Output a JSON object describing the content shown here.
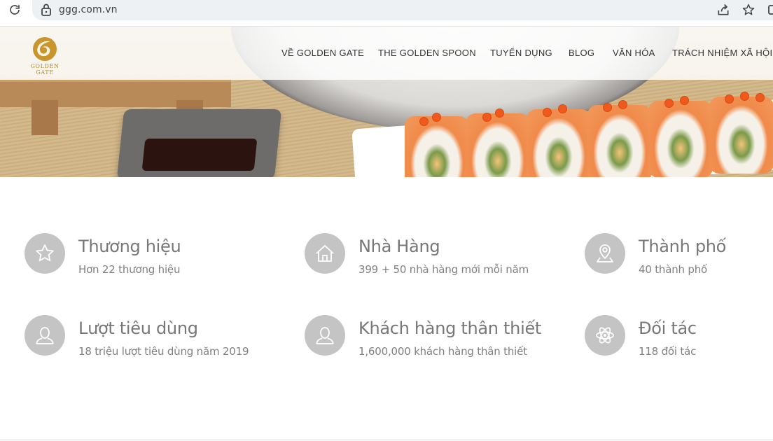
{
  "browser": {
    "url": "ggg.com.vn",
    "icons": [
      "reload-icon",
      "lock-icon",
      "share-icon",
      "star-icon"
    ]
  },
  "logo": {
    "text": "GOLDEN GATE",
    "color": "#c9962e"
  },
  "nav": {
    "items": [
      {
        "label": "VỀ GOLDEN GATE"
      },
      {
        "label": "THE GOLDEN SPOON"
      },
      {
        "label": "TUYỂN DỤNG"
      },
      {
        "label": "BLOG"
      },
      {
        "label": "VĂN HÓA"
      },
      {
        "label": "TRÁCH NHIỆM XÃ HỘI"
      }
    ]
  },
  "features": [
    {
      "icon": "star-icon",
      "title": "Thương hiệu",
      "subtitle": "Hơn 22 thương hiệu"
    },
    {
      "icon": "home-icon",
      "title": "Nhà Hàng",
      "subtitle": "399 + 50 nhà hàng mới mỗi năm"
    },
    {
      "icon": "map-pin-icon",
      "title": "Thành phố",
      "subtitle": "40 thành phố"
    },
    {
      "icon": "user-icon",
      "title": "Lượt tiêu dùng",
      "subtitle": "18 triệu lượt tiêu dùng năm 2019"
    },
    {
      "icon": "user-icon",
      "title": "Khách hàng thân thiết",
      "subtitle": "1,600,000 khách hàng thân thiết"
    },
    {
      "icon": "atom-icon",
      "title": "Đối tác",
      "subtitle": "118 đối tác"
    }
  ],
  "colors": {
    "icon_circle": "#c4c4c4",
    "feature_text": "#777777",
    "nav_text": "#333333"
  }
}
